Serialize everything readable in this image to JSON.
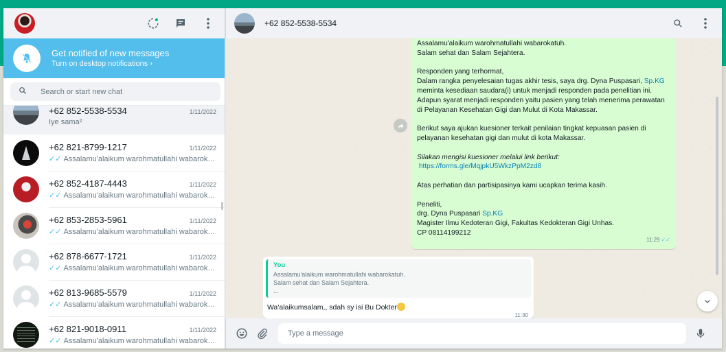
{
  "colors": {
    "accent": "#00a884",
    "notify": "#53bdeb",
    "outgoing_bubble": "#d9fdd3",
    "link": "#027eb5",
    "tick_read": "#53bdeb"
  },
  "sidebar": {
    "header_icons": [
      "status-icon",
      "new-chat-icon",
      "menu-icon"
    ],
    "notification": {
      "title": "Get notified of new messages",
      "subtitle": "Turn on desktop notifications ›"
    },
    "search": {
      "placeholder": "Search or start new chat"
    },
    "chats": [
      {
        "name": "+62 852-5538-5534",
        "date": "1/11/2022",
        "preview": "Iye sama²",
        "ticks": "",
        "avatar": "av-sky"
      },
      {
        "name": "+62 821-8799-1217",
        "date": "1/11/2022",
        "preview": "Assalamu'alaikum warohmatullahi wabarokatuh.",
        "ticks": "✓✓",
        "avatar": "av-dark"
      },
      {
        "name": "+62 852-4187-4443",
        "date": "1/11/2022",
        "preview": "Assalamu'alaikum warohmatullahi wabarokatuh.",
        "ticks": "✓✓",
        "avatar": "av-red"
      },
      {
        "name": "+62 853-2853-5961",
        "date": "1/11/2022",
        "preview": "Assalamu'alaikum warohmatullahi wabarokatuh.",
        "ticks": "✓✓",
        "avatar": "av-photo"
      },
      {
        "name": "+62 878-6677-1721",
        "date": "1/11/2022",
        "preview": "Assalamu'alaikum warohmatullahi wabarokatuh.",
        "ticks": "✓✓",
        "avatar": "av-default"
      },
      {
        "name": "+62 813-9685-5579",
        "date": "1/11/2022",
        "preview": "Assalamu'alaikum warohmatullahi wabarokatuh.",
        "ticks": "✓✓",
        "avatar": "av-default"
      },
      {
        "name": "+62 821-9018-0911",
        "date": "1/11/2022",
        "preview": "Assalamu'alaikum warohmatullahi wabarokatuh.",
        "ticks": "✓✓",
        "avatar": "av-text"
      }
    ]
  },
  "chat": {
    "contact_name": "+62 852-5538-5534",
    "outgoing": {
      "p1a": "Assalamu'alaikum warohmatullahi wabarokatuh.",
      "p1b": "Salam sehat dan Salam Sejahtera.",
      "p2a": "Responden yang terhormat,",
      "p2b_pre": "Dalam rangka penyelesaian tugas akhir tesis, saya drg. Dyna Puspasari, ",
      "sp_kg": "Sp.KG",
      "p2c": "meminta kesediaan saudara(i) untuk menjadi responden pada penelitian ini.",
      "p2d": "Adapun syarat menjadi responden yaitu pasien yang telah menerima perawatan",
      "p2e": "di Pelayanan Kesehatan Gigi dan Mulut di Kota Makassar.",
      "p3a": "Berikut saya ajukan kuesioner terkait penilaian tingkat kepuasan pasien di",
      "p3b": "pelayanan kesehatan gigi dan mulut di kota Makassar.",
      "p4a": "Silakan mengisi  kuesioner melalui link berikut:",
      "link": "https://forms.gle/MqjpkU5WkzPpM2zd8",
      "p5": "Atas perhatian dan partisipasinya kami ucapkan terima kasih.",
      "p6a": "Peneliti,",
      "p6b_pre": "drg. Dyna Puspasari ",
      "p6c": "Magister Ilmu Kedoteran Gigi, Fakultas Kedokteran Gigi Unhas.",
      "p6d": "CP 08114199212",
      "time": "11:29",
      "ticks": "✓✓"
    },
    "incoming": {
      "quote_author": "You",
      "quote_line1": "Assalamu'alaikum warohmatullahi wabarokatuh.",
      "quote_line2": "Salam sehat dan Salam Sejahtera.",
      "quote_more": "...",
      "text": "Wa'alaikumsalam,, sdah sy isi Bu Dokter",
      "time": "11:30"
    },
    "composer": {
      "placeholder": "Type a message"
    }
  }
}
